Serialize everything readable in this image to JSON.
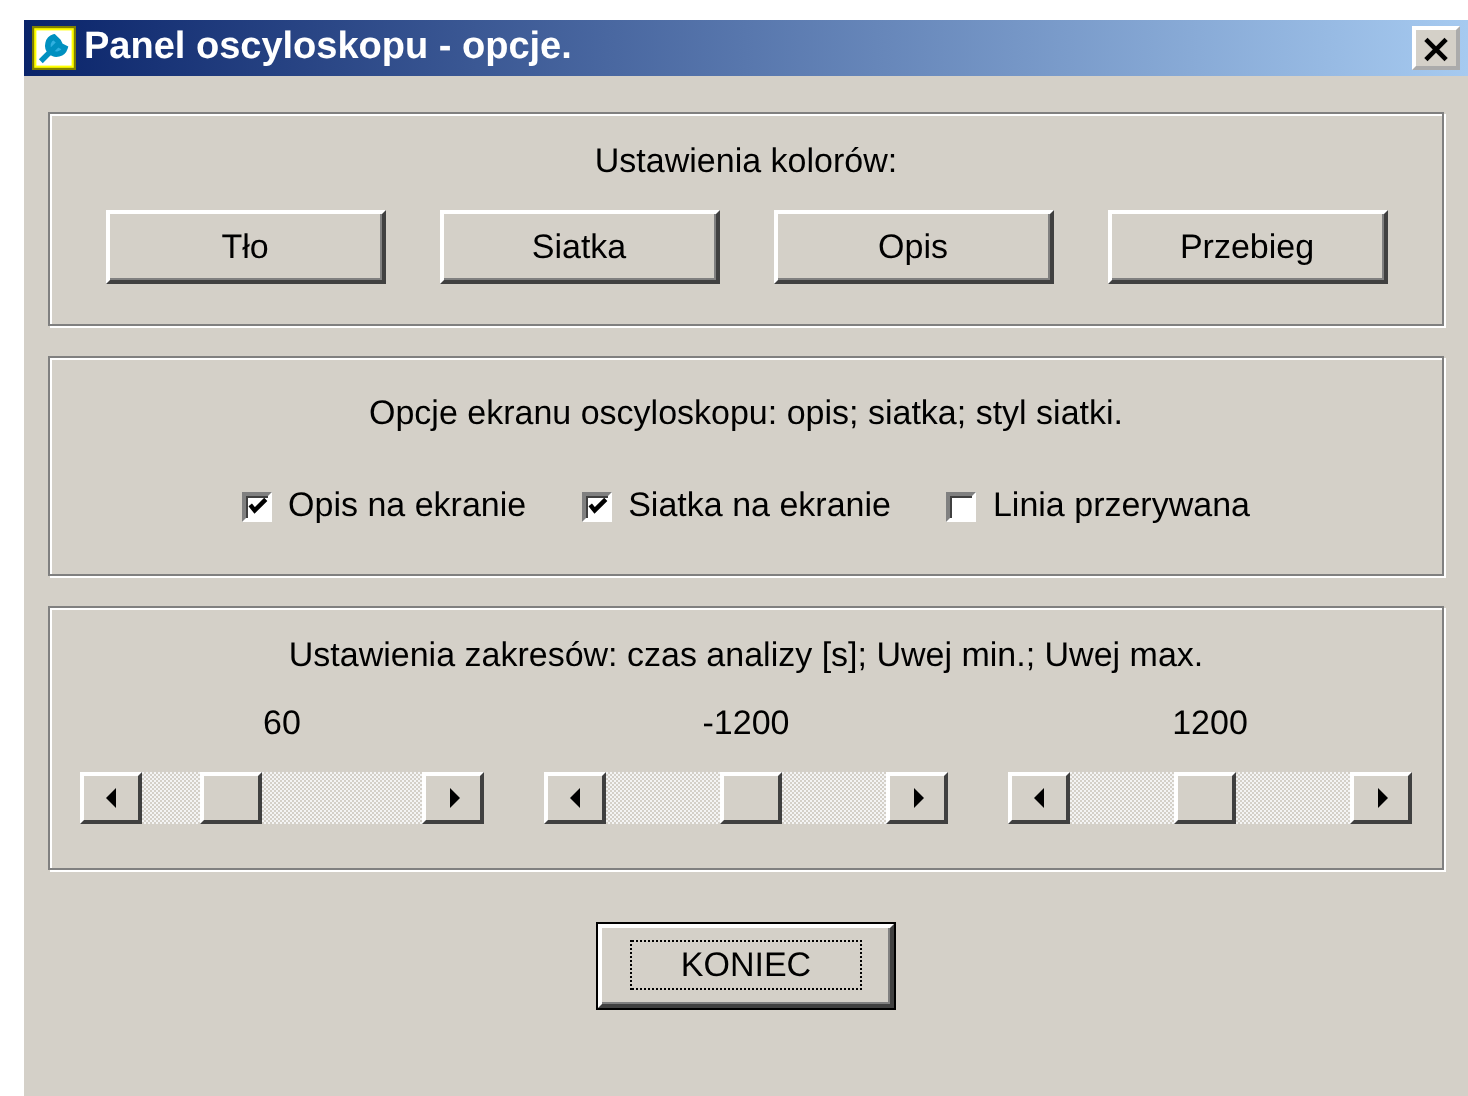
{
  "window": {
    "title": "Panel oscyloskopu - opcje.",
    "close": "×"
  },
  "colors": {
    "heading": "Ustawienia kolorów:",
    "buttons": [
      "Tło",
      "Siatka",
      "Opis",
      "Przebieg"
    ]
  },
  "display": {
    "heading": "Opcje ekranu oscyloskopu: opis; siatka; styl siatki.",
    "options": [
      {
        "label": "Opis na ekranie",
        "checked": true
      },
      {
        "label": "Siatka na ekranie",
        "checked": true
      },
      {
        "label": "Linia przerywana",
        "checked": false
      }
    ]
  },
  "ranges": {
    "heading": "Ustawienia zakresów: czas analizy [s]; Uwej min.; Uwej max.",
    "sliders": [
      {
        "reading": "60",
        "level": 0.27
      },
      {
        "reading": "-1200",
        "level": 0.52
      },
      {
        "reading": "1200",
        "level": 0.48
      }
    ]
  },
  "buttons": [
    {
      "label": "KONIEC",
      "selected": true
    }
  ]
}
